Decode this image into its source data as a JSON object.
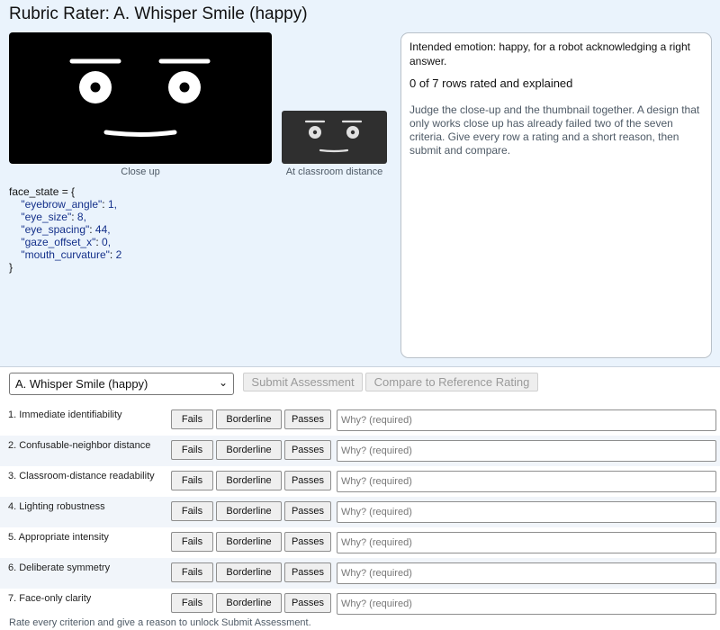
{
  "title": "Rubric Rater: A. Whisper Smile (happy)",
  "preview": {
    "large_caption": "Close up",
    "small_caption": "At classroom distance",
    "large_bg": "#000000",
    "small_bg": "#2f2f2f"
  },
  "face_state": {
    "open": "face_state = {",
    "close": "}",
    "entries": [
      {
        "key": "\"eyebrow_angle\"",
        "value": " 1,"
      },
      {
        "key": "\"eye_size\"",
        "value": " 8,"
      },
      {
        "key": "\"eye_spacing\"",
        "value": " 44,"
      },
      {
        "key": "\"gaze_offset_x\"",
        "value": " 0,"
      },
      {
        "key": "\"mouth_curvature\"",
        "value": " 2"
      }
    ]
  },
  "info": {
    "intended": "Intended emotion: happy, for a robot acknowledging a right answer.",
    "progress": "0 of 7 rows rated and explained",
    "guidance": "Judge the close-up and the thumbnail together. A design that only works close up has already failed two of the seven criteria. Give every row a rating and a short reason, then submit and compare."
  },
  "controls": {
    "selected_design": "A. Whisper Smile (happy)",
    "submit_label": "Submit Assessment",
    "compare_label": "Compare to Reference Rating"
  },
  "rating_labels": {
    "fails": "Fails",
    "borderline": "Borderline",
    "passes": "Passes"
  },
  "why_placeholder": "Why? (required)",
  "criteria": [
    "1. Immediate identifiability",
    "2. Confusable-neighbor distance",
    "3. Classroom-distance readability",
    "4. Lighting robustness",
    "5. Appropriate intensity",
    "6. Deliberate symmetry",
    "7. Face-only clarity"
  ],
  "hint": "Rate every criterion and give a reason to unlock Submit Assessment."
}
